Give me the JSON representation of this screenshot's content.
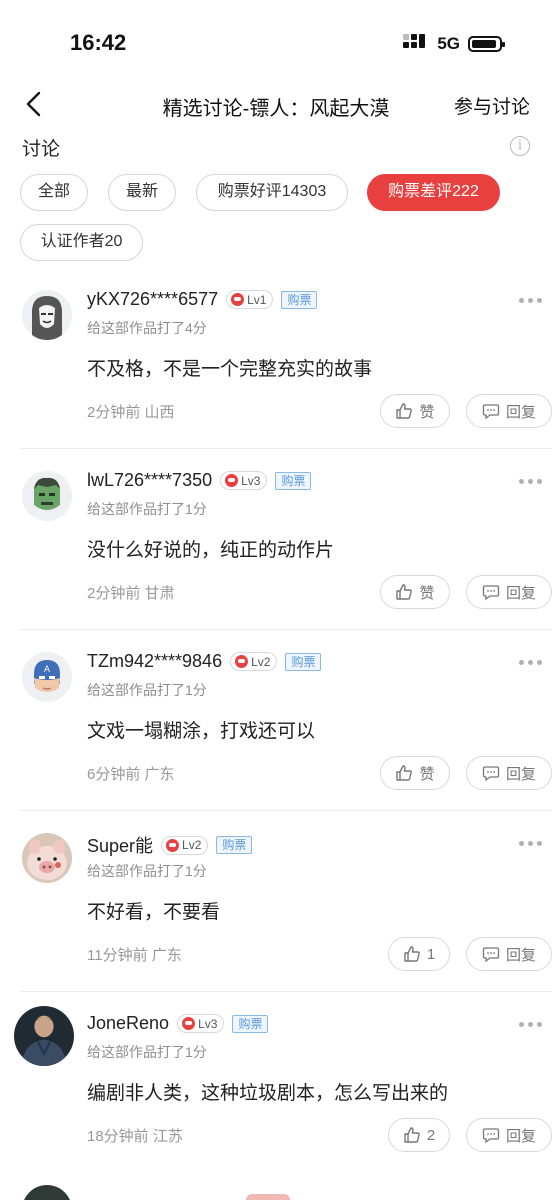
{
  "status": {
    "time": "16:42",
    "network": "5G"
  },
  "nav": {
    "title": "精选讨论-镖人：风起大漠",
    "action": "参与讨论"
  },
  "section": {
    "title": "讨论",
    "info_glyph": "i"
  },
  "filters": [
    {
      "label": "全部",
      "active": false
    },
    {
      "label": "最新",
      "active": false
    },
    {
      "label": "购票好评14303",
      "active": false
    },
    {
      "label": "购票差评222",
      "active": true
    },
    {
      "label": "认证作者20",
      "active": false
    }
  ],
  "comments": [
    {
      "username": "yKX726****6577",
      "level": "Lv1",
      "tag": "购票",
      "score_text": "给这部作品打了4分",
      "content": "不及格，不是一个完整充实的故事",
      "time": "2分钟前",
      "location": "山西",
      "like_label": "赞",
      "reply_label": "回复",
      "avatar": "mask-avatar"
    },
    {
      "username": "lwL726****7350",
      "level": "Lv3",
      "tag": "购票",
      "score_text": "给这部作品打了1分",
      "content": "没什么好说的，纯正的动作片",
      "time": "2分钟前",
      "location": "甘肃",
      "like_label": "赞",
      "reply_label": "回复",
      "avatar": "hulk-avatar"
    },
    {
      "username": "TZm942****9846",
      "level": "Lv2",
      "tag": "购票",
      "score_text": "给这部作品打了1分",
      "content": "文戏一塌糊涂，打戏还可以",
      "time": "6分钟前",
      "location": "广东",
      "like_label": "赞",
      "reply_label": "回复",
      "avatar": "captain-avatar"
    },
    {
      "username": "Super能",
      "level": "Lv2",
      "tag": "购票",
      "score_text": "给这部作品打了1分",
      "content": "不好看，不要看",
      "time": "11分钟前",
      "location": "广东",
      "like_label": "1",
      "reply_label": "回复",
      "avatar": "pig-avatar"
    },
    {
      "username": "JoneReno",
      "level": "Lv3",
      "tag": "购票",
      "score_text": "给这部作品打了1分",
      "content": "编剧非人类，这种垃圾剧本，怎么写出来的",
      "time": "18分钟前",
      "location": "江苏",
      "like_label": "2",
      "reply_label": "回复",
      "avatar": "photo-avatar"
    }
  ],
  "colors": {
    "accent": "#e8403f",
    "tag_blue": "#5a9ad8",
    "muted": "#999999"
  }
}
